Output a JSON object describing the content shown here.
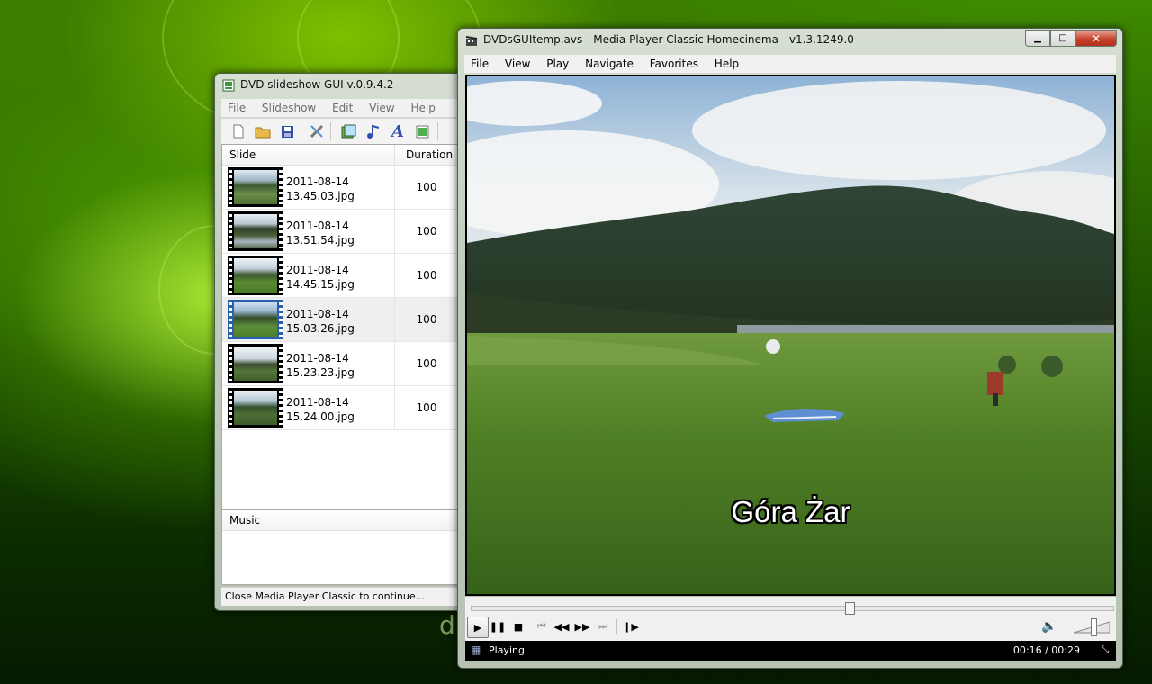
{
  "desktop": {
    "partial_text": "d"
  },
  "dvd_window": {
    "title": "DVD slideshow GUI v.0.9.4.2",
    "menu": [
      "File",
      "Slideshow",
      "Edit",
      "View",
      "Help"
    ],
    "toolbar_icons": [
      "new-file-icon",
      "open-folder-icon",
      "save-icon",
      "tools-icon",
      "add-slide-icon",
      "add-music-icon",
      "text-icon",
      "image-icon"
    ],
    "list_headers": {
      "slide": "Slide",
      "duration": "Duration"
    },
    "slides": [
      {
        "date": "2011-08-14",
        "file": "13.45.03.jpg",
        "duration": "100"
      },
      {
        "date": "2011-08-14",
        "file": "13.51.54.jpg",
        "duration": "100"
      },
      {
        "date": "2011-08-14",
        "file": "14.45.15.jpg",
        "duration": "100"
      },
      {
        "date": "2011-08-14",
        "file": "15.03.26.jpg",
        "duration": "100"
      },
      {
        "date": "2011-08-14",
        "file": "15.23.23.jpg",
        "duration": "100"
      },
      {
        "date": "2011-08-14",
        "file": "15.24.00.jpg",
        "duration": "100"
      }
    ],
    "selected_slide_index": 3,
    "music_header": "Music",
    "status": "Close Media Player Classic to continue..."
  },
  "mpc_window": {
    "title": "DVDsGUItemp.avs - Media Player Classic Homecinema - v1.3.1249.0",
    "menu": [
      "File",
      "View",
      "Play",
      "Navigate",
      "Favorites",
      "Help"
    ],
    "caption": "Góra Żar",
    "seek_fraction": 0.59,
    "volume_fraction": 0.55,
    "status": "Playing",
    "time": "00:16 / 00:29"
  }
}
